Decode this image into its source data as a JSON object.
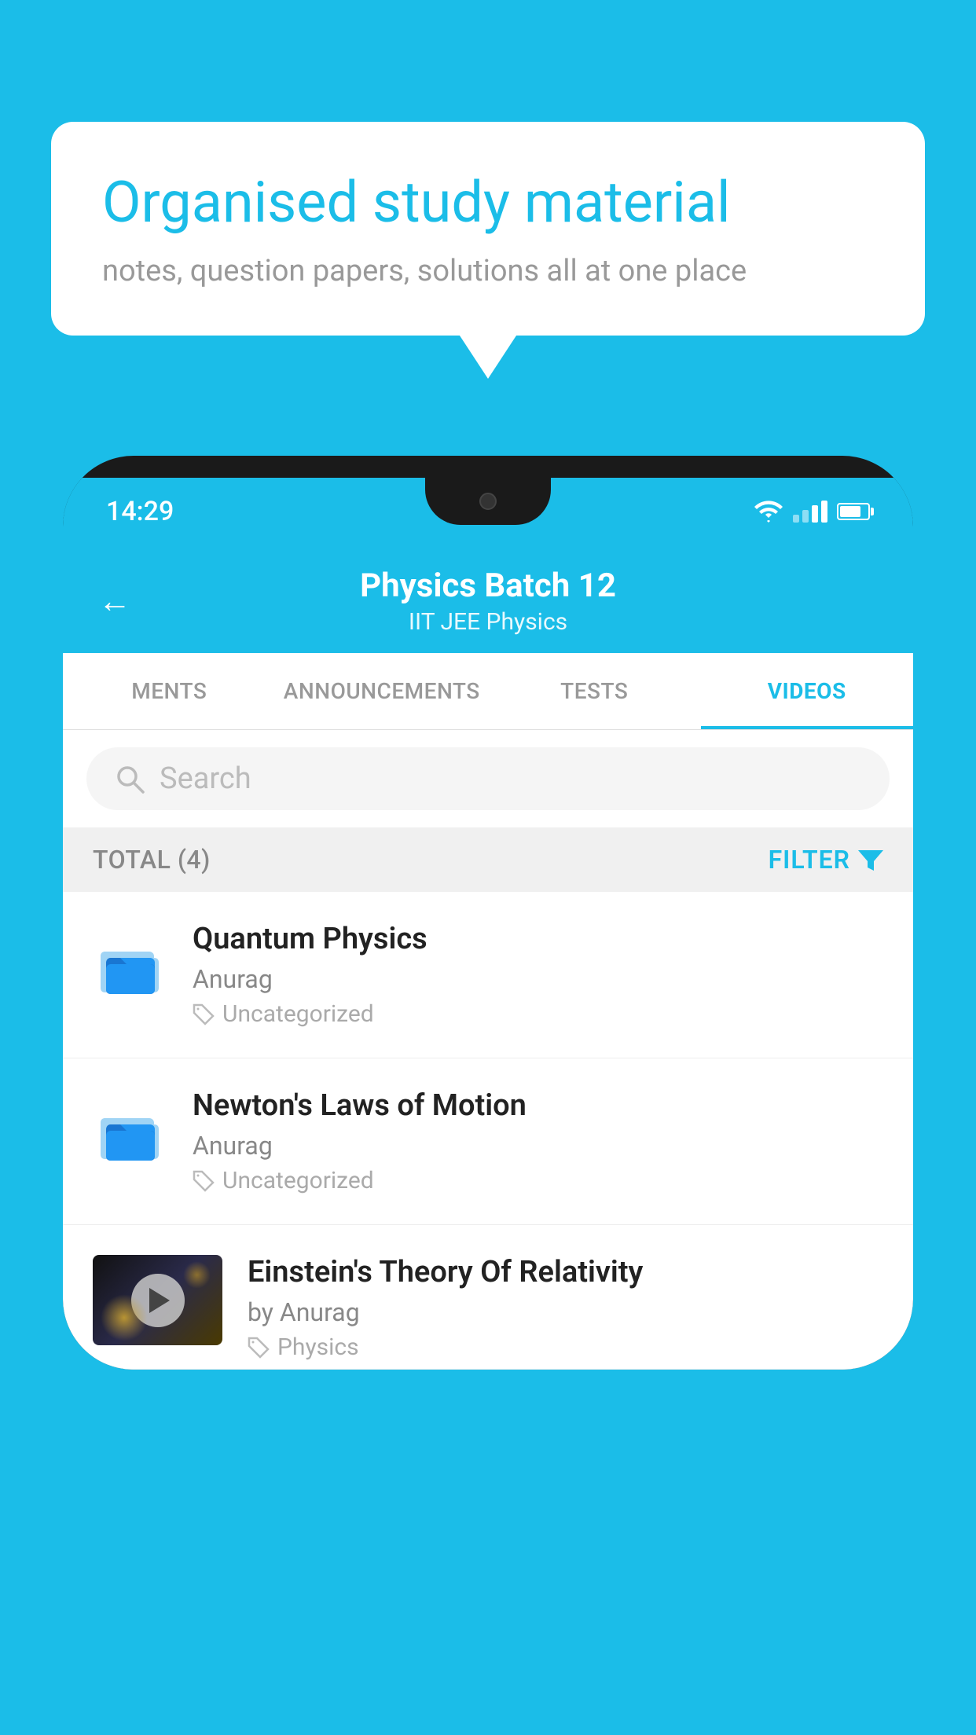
{
  "background_color": "#1bbde8",
  "bubble": {
    "title": "Organised study material",
    "subtitle": "notes, question papers, solutions all at one place"
  },
  "phone": {
    "status_bar": {
      "time": "14:29"
    },
    "header": {
      "title": "Physics Batch 12",
      "subtitle": "IIT JEE   Physics",
      "back_label": "←"
    },
    "tabs": [
      {
        "label": "MENTS",
        "active": false
      },
      {
        "label": "ANNOUNCEMENTS",
        "active": false
      },
      {
        "label": "TESTS",
        "active": false
      },
      {
        "label": "VIDEOS",
        "active": true
      }
    ],
    "search": {
      "placeholder": "Search"
    },
    "filter": {
      "total_label": "TOTAL (4)",
      "filter_label": "FILTER"
    },
    "videos": [
      {
        "id": 1,
        "title": "Quantum Physics",
        "author": "Anurag",
        "tag": "Uncategorized",
        "type": "folder"
      },
      {
        "id": 2,
        "title": "Newton's Laws of Motion",
        "author": "Anurag",
        "tag": "Uncategorized",
        "type": "folder"
      },
      {
        "id": 3,
        "title": "Einstein's Theory Of Relativity",
        "author": "by Anurag",
        "tag": "Physics",
        "type": "video"
      }
    ]
  }
}
